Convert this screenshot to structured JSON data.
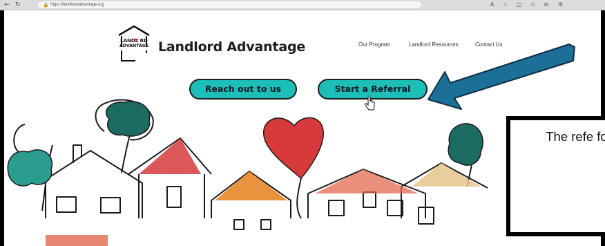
{
  "browser": {
    "url": "https://landlordadvantage.org",
    "back_icon": "back-arrow-icon",
    "refresh_icon": "refresh-icon"
  },
  "site": {
    "logo_text_line1": "LANDL RD",
    "logo_text_line2": "ADVANTAGE",
    "brand_name": "Landlord Advantage",
    "nav": [
      "Our Program",
      "Landlord Resources",
      "Contact Us"
    ]
  },
  "buttons": {
    "reach_out": "Reach out to us",
    "start_referral": "Start a Referral"
  },
  "callout": {
    "text": "The refe for h prope"
  },
  "colors": {
    "teal": "#1dbeb8",
    "arrow": "#1c6f96",
    "heart": "#d63a3a"
  }
}
